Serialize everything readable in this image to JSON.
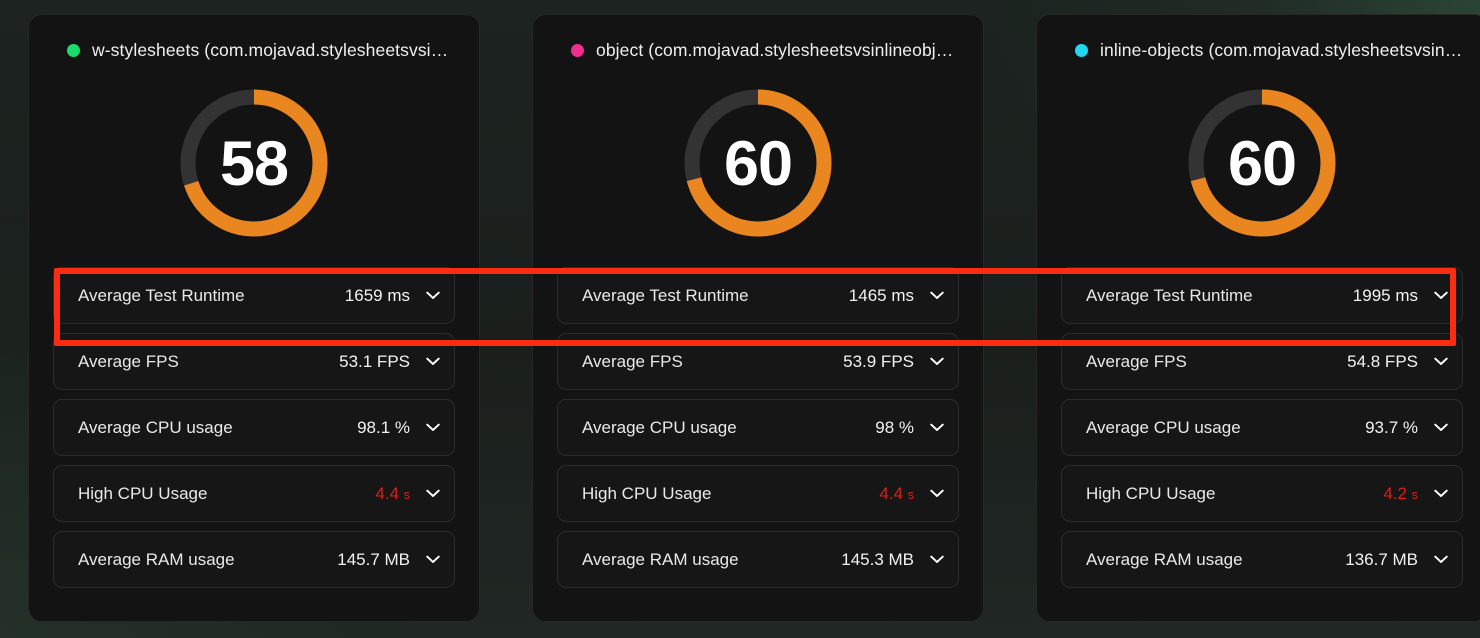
{
  "colors": {
    "gauge_fill": "#ea8620",
    "gauge_track": "#333333",
    "annotation": "#fa2d11",
    "warn_text": "#e31b14",
    "card_bg": "#131313"
  },
  "annotation": {
    "label": "Average Test Runtime row highlight"
  },
  "cards": [
    {
      "dot_color": "#19dd6a",
      "title": "w-stylesheets (com.mojavad.stylesheetsvsin...",
      "gauge": {
        "value": "58",
        "percent": 70,
        "max": 60
      },
      "metrics": [
        {
          "label": "Average Test Runtime",
          "value": "1659 ms",
          "warn": false,
          "chevron": "chevron-down-icon"
        },
        {
          "label": "Average FPS",
          "value": "53.1 FPS",
          "warn": false,
          "chevron": "chevron-down-icon"
        },
        {
          "label": "Average CPU usage",
          "value": "98.1 %",
          "warn": false,
          "chevron": "chevron-down-icon"
        },
        {
          "label": "High CPU Usage",
          "value": "4.4",
          "unit": "s",
          "warn": true,
          "chevron": "chevron-down-icon"
        },
        {
          "label": "Average RAM usage",
          "value": "145.7 MB",
          "warn": false,
          "chevron": "chevron-down-icon"
        }
      ]
    },
    {
      "dot_color": "#f22d8f",
      "title": "object (com.mojavad.stylesheetsvsinlineobje...",
      "gauge": {
        "value": "60",
        "percent": 71,
        "max": 60
      },
      "metrics": [
        {
          "label": "Average Test Runtime",
          "value": "1465 ms",
          "warn": false,
          "chevron": "chevron-down-icon"
        },
        {
          "label": "Average FPS",
          "value": "53.9 FPS",
          "warn": false,
          "chevron": "chevron-down-icon"
        },
        {
          "label": "Average CPU usage",
          "value": "98 %",
          "warn": false,
          "chevron": "chevron-down-icon"
        },
        {
          "label": "High CPU Usage",
          "value": "4.4",
          "unit": "s",
          "warn": true,
          "chevron": "chevron-down-icon"
        },
        {
          "label": "Average RAM usage",
          "value": "145.3 MB",
          "warn": false,
          "chevron": "chevron-down-icon"
        }
      ]
    },
    {
      "dot_color": "#20d8f0",
      "title": "inline-objects (com.mojavad.stylesheetsvsinl...",
      "gauge": {
        "value": "60",
        "percent": 71,
        "max": 60
      },
      "metrics": [
        {
          "label": "Average Test Runtime",
          "value": "1995 ms",
          "warn": false,
          "chevron": "chevron-down-icon"
        },
        {
          "label": "Average FPS",
          "value": "54.8 FPS",
          "warn": false,
          "chevron": "chevron-down-icon"
        },
        {
          "label": "Average CPU usage",
          "value": "93.7 %",
          "warn": false,
          "chevron": "chevron-down-icon"
        },
        {
          "label": "High CPU Usage",
          "value": "4.2",
          "unit": "s",
          "warn": true,
          "chevron": "chevron-down-icon"
        },
        {
          "label": "Average RAM usage",
          "value": "136.7 MB",
          "warn": false,
          "chevron": "chevron-down-icon"
        }
      ]
    }
  ]
}
